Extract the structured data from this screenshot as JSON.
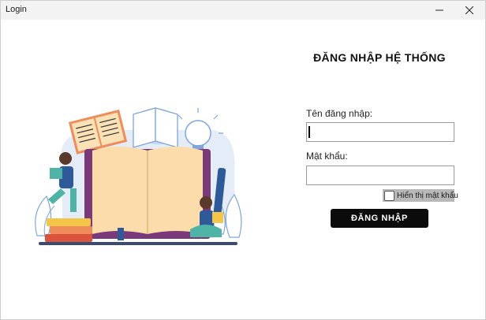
{
  "window": {
    "title": "Login",
    "minimize_glyph": "minimize-icon",
    "close_glyph": "close-icon"
  },
  "login_form": {
    "heading": "ĐĂNG NHẬP HỆ THỐNG",
    "username_label": "Tên đăng nhập:",
    "username_value": "",
    "password_label": "Mật khẩu:",
    "password_value": "",
    "show_password_label": "Hiển thị mật khẩu",
    "show_password_checked": false,
    "submit_label": "ĐĂNG NHẬP"
  },
  "illustration": {
    "subject": "books-and-readers-illustration"
  },
  "colors": {
    "titlebar": "#f3f3f3",
    "button_bg": "#0b0b0b",
    "button_text": "#ffffff",
    "checkbox_bg": "#b8b8b8"
  }
}
